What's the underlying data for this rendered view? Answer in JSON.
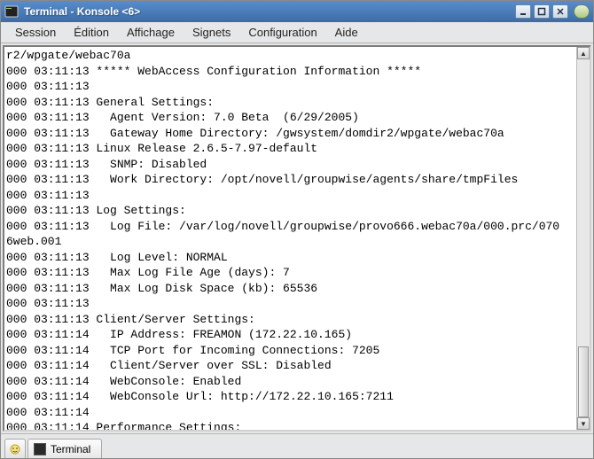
{
  "window": {
    "title": "Terminal - Konsole <6>"
  },
  "menu": {
    "session": "Session",
    "edition": "Édition",
    "affichage": "Affichage",
    "signets": "Signets",
    "configuration": "Configuration",
    "aide": "Aide"
  },
  "tabs": {
    "terminal": "Terminal"
  },
  "terminal": {
    "lines": [
      "r2/wpgate/webac70a",
      "000 03:11:13 ***** WebAccess Configuration Information *****",
      "000 03:11:13",
      "000 03:11:13 General Settings:",
      "000 03:11:13   Agent Version: 7.0 Beta  (6/29/2005)",
      "000 03:11:13   Gateway Home Directory: /gwsystem/domdir2/wpgate/webac70a",
      "000 03:11:13 Linux Release 2.6.5-7.97-default",
      "000 03:11:13   SNMP: Disabled",
      "000 03:11:13   Work Directory: /opt/novell/groupwise/agents/share/tmpFiles",
      "000 03:11:13",
      "000 03:11:13 Log Settings:",
      "000 03:11:13   Log File: /var/log/novell/groupwise/provo666.webac70a/000.prc/070",
      "6web.001",
      "000 03:11:13   Log Level: NORMAL",
      "000 03:11:13   Max Log File Age (days): 7",
      "000 03:11:13   Max Log Disk Space (kb): 65536",
      "000 03:11:13",
      "000 03:11:13 Client/Server Settings:",
      "000 03:11:14   IP Address: FREAMON (172.22.10.165)",
      "000 03:11:14   TCP Port for Incoming Connections: 7205",
      "000 03:11:14   Client/Server over SSL: Disabled",
      "000 03:11:14   WebConsole: Enabled",
      "000 03:11:14   WebConsole Url: http://172.22.10.165:7211",
      "000 03:11:14",
      "000 03:11:14 Performance Settings:"
    ]
  }
}
